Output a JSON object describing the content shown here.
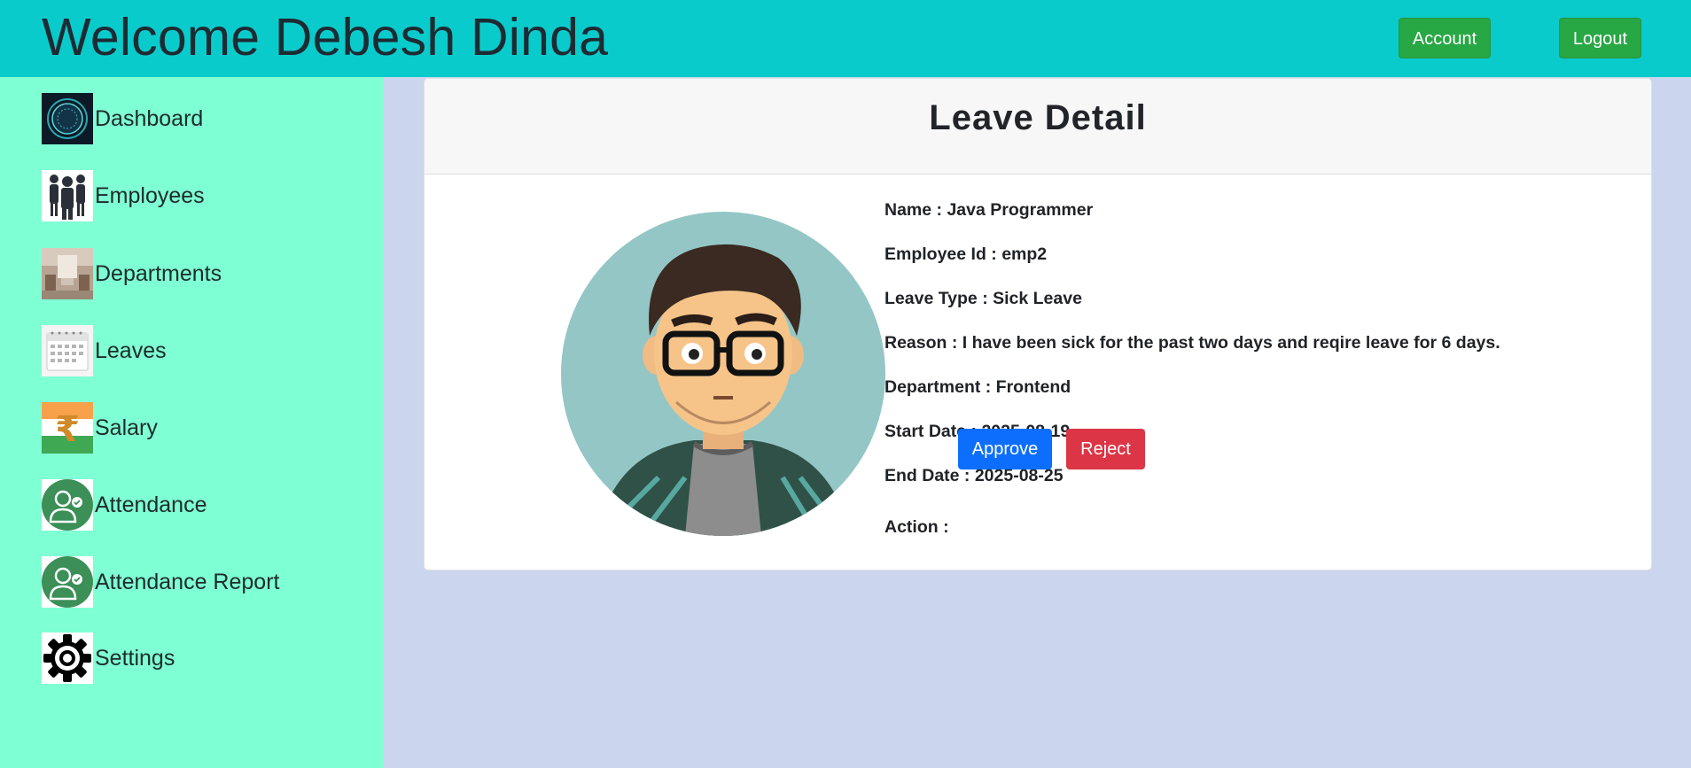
{
  "header": {
    "welcome": "Welcome Debesh Dinda",
    "account_label": "Account",
    "logout_label": "Logout"
  },
  "sidebar": {
    "items": [
      {
        "label": "Dashboard",
        "icon": "dashboard-icon"
      },
      {
        "label": "Employees",
        "icon": "employees-icon"
      },
      {
        "label": "Departments",
        "icon": "departments-icon"
      },
      {
        "label": "Leaves",
        "icon": "calendar-icon"
      },
      {
        "label": "Salary",
        "icon": "rupee-icon"
      },
      {
        "label": "Attendance",
        "icon": "attendance-icon"
      },
      {
        "label": "Attendance Report",
        "icon": "attendance-report-icon"
      },
      {
        "label": "Settings",
        "icon": "gear-icon"
      }
    ]
  },
  "leave": {
    "title": "Leave Detail",
    "name": "Name : Java Programmer",
    "employee_id": "Employee Id : emp2",
    "leave_type": "Leave Type : Sick Leave",
    "reason": "Reason : I have been sick for the past two days and reqire leave for 6 days.",
    "department": "Department : Frontend",
    "start_date": "Start Date : 2025-08-19",
    "end_date": "End Date : 2025-08-25",
    "action_label": "Action :",
    "approve_label": "Approve",
    "reject_label": "Reject"
  },
  "colors": {
    "topbar": "#0acbcb",
    "sidebar": "#7fffd4",
    "background": "#cbd5ee",
    "green_button": "#28a745",
    "approve": "#0d6efd",
    "reject": "#dc3545"
  }
}
